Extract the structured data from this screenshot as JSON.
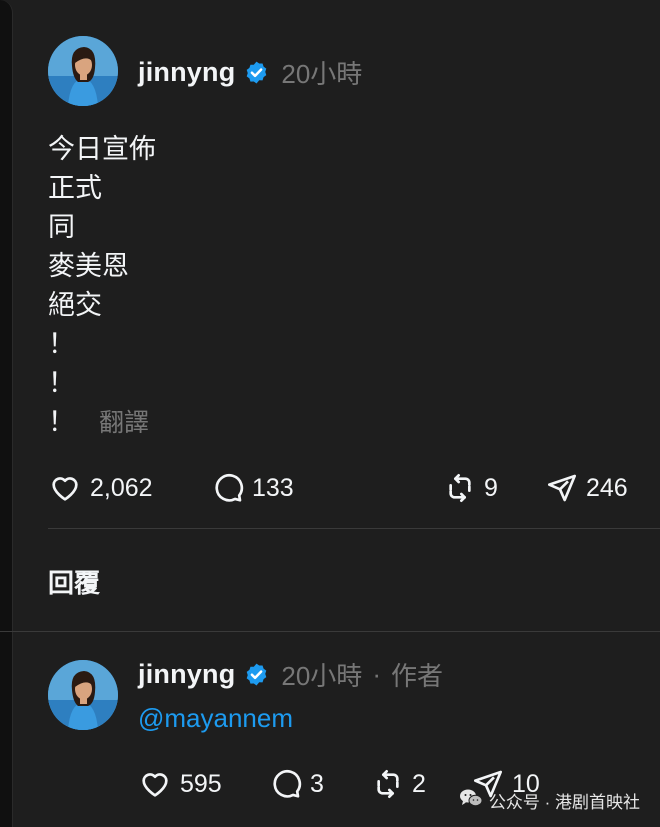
{
  "post": {
    "username": "jinnyng",
    "timestamp": "20小時",
    "lines": [
      "今日宣佈",
      "正式",
      "同",
      "麥美恩",
      "絕交",
      "！",
      "！",
      "！"
    ],
    "translate_label": "翻譯",
    "actions": {
      "likes": "2,062",
      "comments": "133",
      "reposts": "9",
      "shares": "246"
    }
  },
  "replies_heading": "回覆",
  "reply": {
    "username": "jinnyng",
    "timestamp": "20小時",
    "separator": "·",
    "author_tag": "作者",
    "mention": "@mayannem",
    "actions": {
      "likes": "595",
      "comments": "3",
      "reposts": "2",
      "shares": "10"
    }
  },
  "watermark": {
    "text": "公众号 · 港剧首映社"
  },
  "icons": {
    "verified": "verified-badge-icon",
    "like": "heart-icon",
    "comment": "comment-bubble-icon",
    "repost": "repost-icon",
    "share": "send-icon",
    "watermark": "wechat-icon"
  },
  "colors": {
    "background": "#1e1e1e",
    "text": "#f3f5f7",
    "muted": "#777777",
    "verified": "#1d9bf0",
    "mention": "#1d9bf0"
  }
}
